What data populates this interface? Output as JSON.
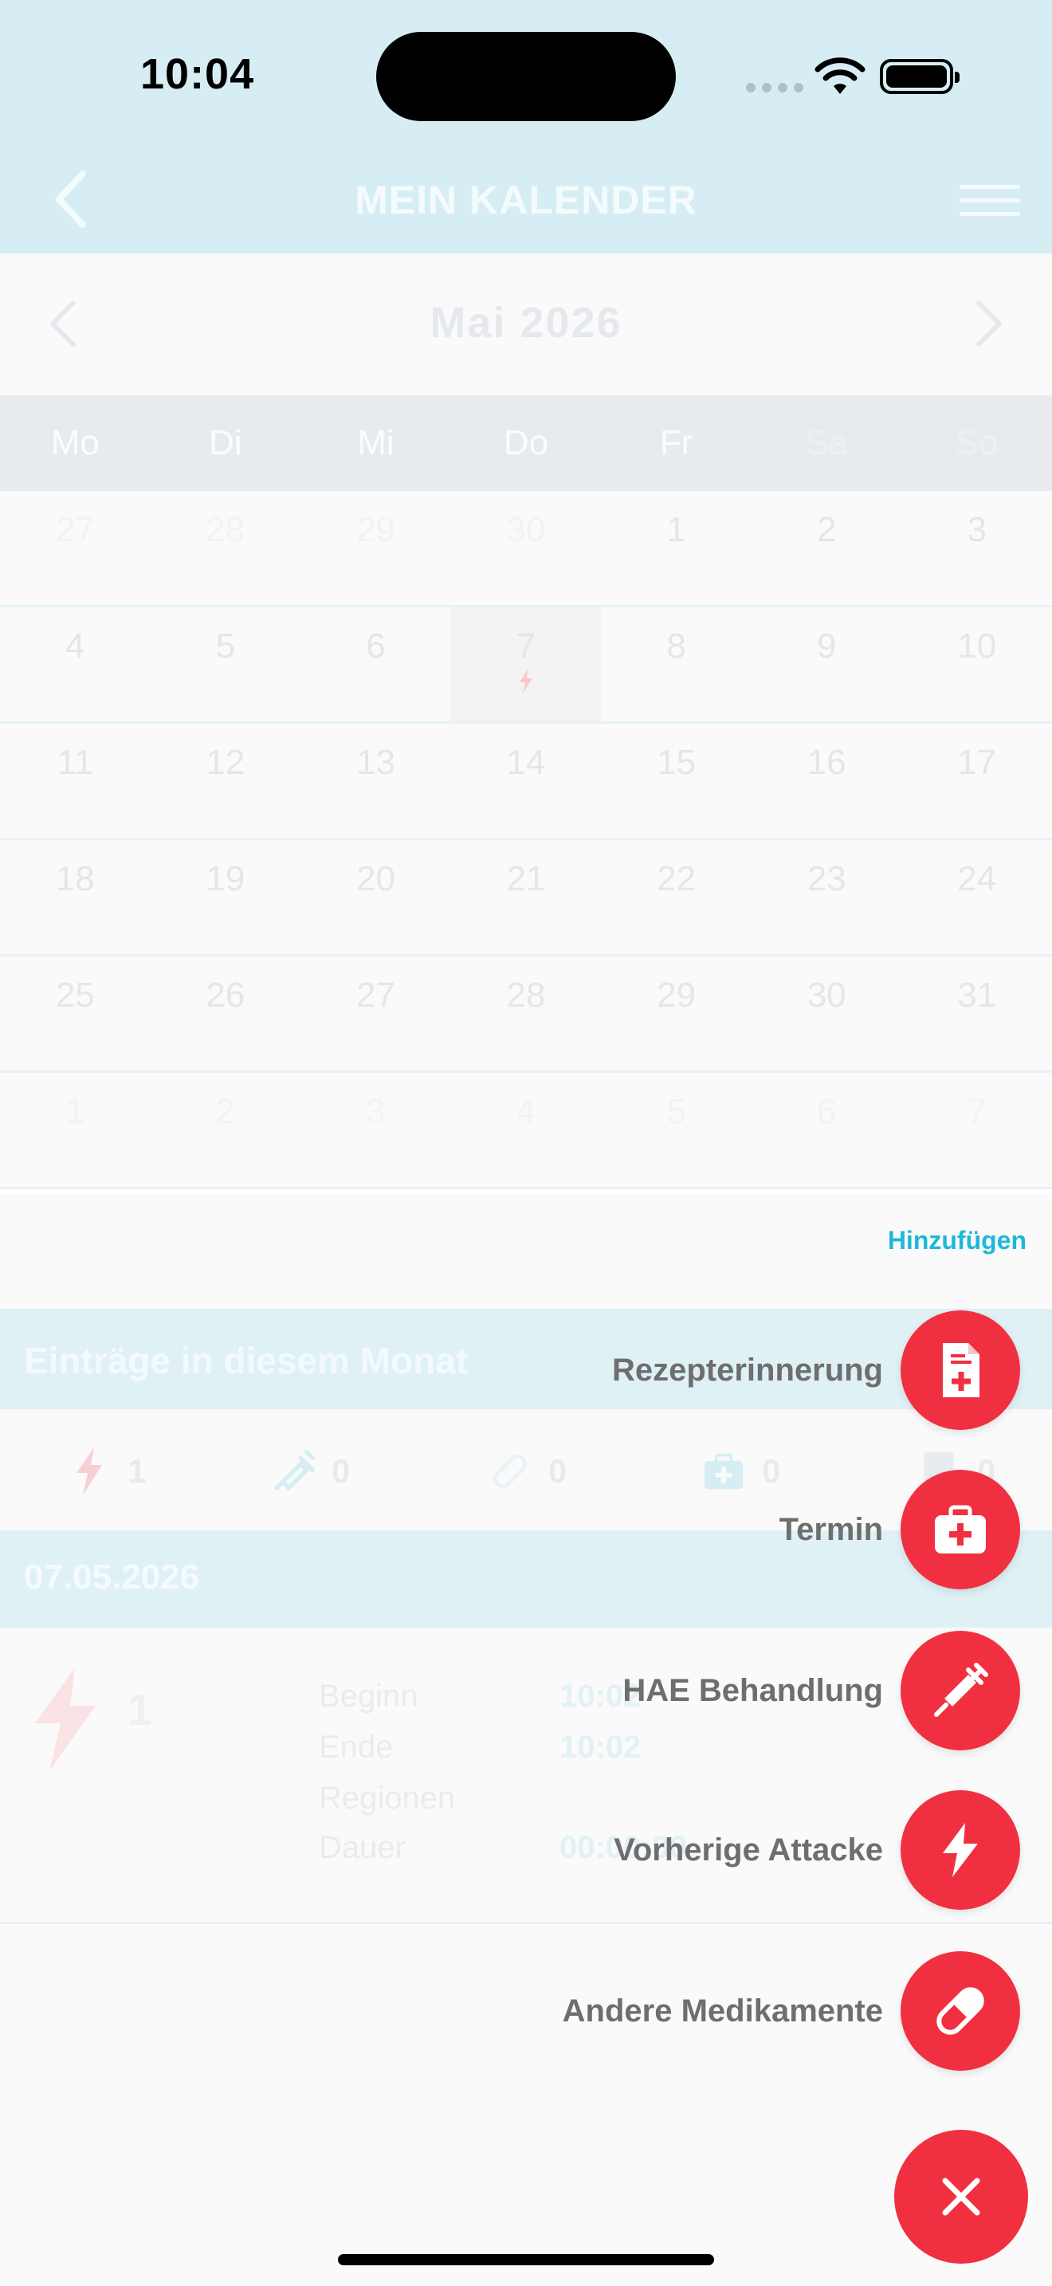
{
  "status": {
    "time": "10:04"
  },
  "header": {
    "title": "MEIN KALENDER"
  },
  "calendar": {
    "month_label": "Mai 2026",
    "weekdays": [
      "Mo",
      "Di",
      "Mi",
      "Do",
      "Fr",
      "Sa",
      "So"
    ],
    "weeks": [
      [
        "27",
        "28",
        "29",
        "30",
        "1",
        "2",
        "3"
      ],
      [
        "4",
        "5",
        "6",
        "7",
        "8",
        "9",
        "10"
      ],
      [
        "11",
        "12",
        "13",
        "14",
        "15",
        "16",
        "17"
      ],
      [
        "18",
        "19",
        "20",
        "21",
        "22",
        "23",
        "24"
      ],
      [
        "25",
        "26",
        "27",
        "28",
        "29",
        "30",
        "31"
      ],
      [
        "1",
        "2",
        "3",
        "4",
        "5",
        "6",
        "7"
      ]
    ]
  },
  "add_link": "Hinzufügen",
  "entries": {
    "title": "Einträge in diesem Monat",
    "counts": {
      "attacks": "1",
      "treatments": "0",
      "medications": "0",
      "appointments": "0",
      "prescriptions": "0"
    }
  },
  "day_entry": {
    "date": "07.05.2026",
    "count": "1",
    "rows": [
      {
        "label": "Beginn",
        "value": "10:02"
      },
      {
        "label": "Ende",
        "value": "10:02"
      },
      {
        "label": "Regionen",
        "value": ""
      },
      {
        "label": "Dauer",
        "value": "00:00:00"
      }
    ]
  },
  "fab_menu": {
    "items": [
      {
        "label": "Rezepterinnerung",
        "icon": "prescription-icon"
      },
      {
        "label": "Termin",
        "icon": "first-aid-kit-icon"
      },
      {
        "label": "HAE Behandlung",
        "icon": "syringe-icon"
      },
      {
        "label": "Vorherige Attacke",
        "icon": "lightning-icon"
      },
      {
        "label": "Andere Medikamente",
        "icon": "pill-icon"
      }
    ],
    "close_icon": "close-icon"
  },
  "colors": {
    "accent": "#f03040",
    "link": "#1fb7d9",
    "header_bg": "#d6eef3"
  }
}
